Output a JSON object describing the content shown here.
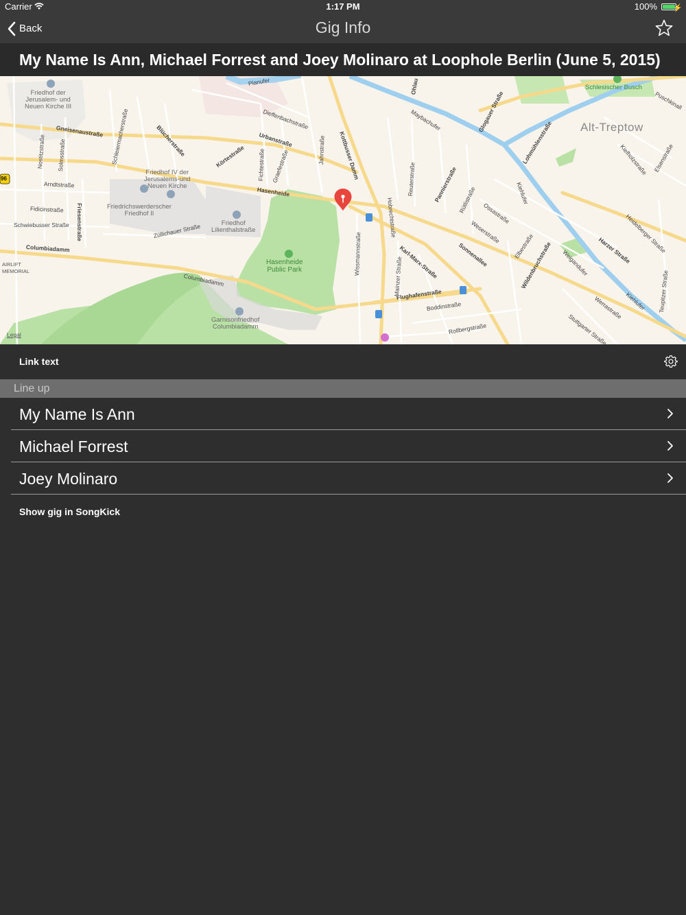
{
  "status_bar": {
    "carrier": "Carrier",
    "time": "1:17 PM",
    "battery": "100%"
  },
  "nav": {
    "back_label": "Back",
    "title": "Gig Info",
    "back_icon": "chevron-left-icon",
    "favorite_icon": "star-outline-icon"
  },
  "gig": {
    "title": "My Name Is Ann, Michael Forrest and Joey Molinaro at Loophole Berlin (June 5, 2015)"
  },
  "map": {
    "area_label": "Alt-Treptow",
    "legal_label": "Legal",
    "road_badge": "96",
    "pin_color": "#e8453c",
    "labels": {
      "friedhof_jerusalem": [
        "Friedhof der",
        "Jerusalem- und",
        "Neuen Kirche III"
      ],
      "friedhof_iv": [
        "Friedhof IV der",
        "Jerusalems-und",
        "Neuen Kirche"
      ],
      "friedrichswerderscher": [
        "Friedrichswerderscher",
        "Friedhof II"
      ],
      "lilienthal": [
        "Friedhof",
        "Lilienthalstraße"
      ],
      "hasenheide_park": [
        "Hasenheide",
        "Public Park"
      ],
      "garnison": [
        "Garnisonfriedhof",
        "Columbiadamm"
      ],
      "airlift": [
        "AIRLIFT",
        "MEMORIAL"
      ],
      "schlesischer_busch": "Schlesischer Busch",
      "streets": {
        "gneisenaustrasse": "Gneisenaustraße",
        "arndtstrasse": "Arndtstraße",
        "fidicinstrasse": "Fidicinstraße",
        "schwiebusser": "Schwiebusser Straße",
        "columbiadamm": "Columbiadamm",
        "friesenstrasse": "Friesenstraße",
        "zuellichauer": "Züllichauer Straße",
        "hasenheide": "Hasenheide",
        "urbanstrasse": "Urbanstraße",
        "kortestrasse": "Körtestraße",
        "bluecherstrasse": "Blücherstraße",
        "dieffenbachstrasse": "Dieffenbachstraße",
        "planufer": "Planufer",
        "kottbusser_damm": "Kottbusser Damm",
        "maybachufer": "Maybachufer",
        "glogauer": "Glogauer Straße",
        "pannierstrasse": "Pannierstraße",
        "karl_marx": "Karl-Marx-Straße",
        "sonnenallee": "Sonnenallee",
        "flughafenstrasse": "Flughafenstraße",
        "boddinstrasse": "Boddinstraße",
        "rollbergstrasse": "Rollbergstraße",
        "weserstrasse": "Weserstraße",
        "harzer": "Harzer Straße",
        "wildenbruchstrasse": "Wildenbruchstraße",
        "lohmuehlenstrasse": "Lohmühlenstraße",
        "heidelberger": "Heidelberger Straße",
        "kiefholz": "Kiefholzstraße",
        "jahnstrasse": "Jahnstraße",
        "wissmannstrasse": "Wissmannstraße",
        "mainzer": "Mainzer Straße",
        "ossastrasse": "Ossastraße",
        "elbestrasse": "Elbestraße",
        "ruetlistrasse": "Rütlistraße",
        "reuterstrasse": "Reuterstraße",
        "hobrechtstrasse": "Hobrechtstraße",
        "stuttgarter": "Stuttgarter Straße",
        "werrastrasse": "Werrastraße",
        "weigandufer": "Weigandufer",
        "kiehlufer": "Kiehlufer",
        "teupitzer": "Teupitzer Straße",
        "puschkinallee": "Puschkinall",
        "ohlauer": "Ohlau",
        "graefestrasse": "Graefestraße",
        "fichtestrasse": "Fichtestraße",
        "solmsstrasse": "Solmsstraße",
        "nostitzstrasse": "Nostitzstraße",
        "schleiermacher": "Schleiermacherstraße",
        "elsenstrasse": "Elsenstraße",
        "lohmuehlen2": "Kiehlufer"
      }
    }
  },
  "actions": {
    "link_text": "Link text",
    "settings_icon": "gear-icon"
  },
  "lineup": {
    "header": "Line up",
    "artists": [
      {
        "name": "My Name Is Ann"
      },
      {
        "name": "Michael Forrest"
      },
      {
        "name": "Joey Molinaro"
      }
    ]
  },
  "footer": {
    "songkick_link": "Show gig in SongKick"
  },
  "colors": {
    "background": "#2e2e2e",
    "bar": "#3a3a3a",
    "section_header": "#6e6e6e",
    "battery": "#4cd964"
  }
}
